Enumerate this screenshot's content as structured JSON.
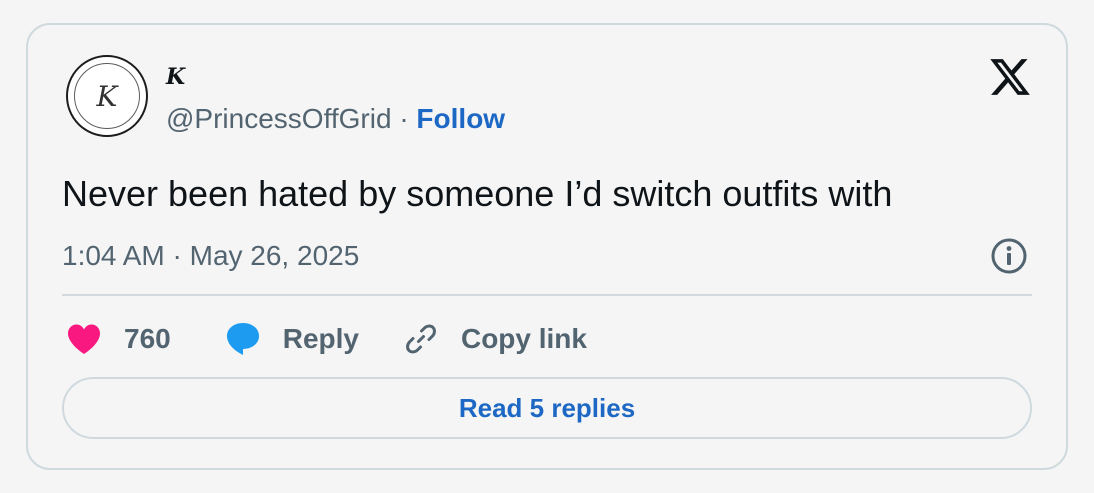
{
  "author": {
    "avatar_letter": "K",
    "display_name": "K",
    "handle": "@PrincessOffGrid",
    "separator": "·",
    "follow_label": "Follow"
  },
  "tweet": {
    "text": "Never been hated by someone I’d switch outfits with",
    "timestamp": "1:04 AM · May 26, 2025"
  },
  "actions": {
    "like_count": "760",
    "reply_label": "Reply",
    "copy_link_label": "Copy link"
  },
  "read_replies_label": "Read 5 replies",
  "icons": {
    "brand": "x-logo-icon",
    "info": "info-icon",
    "like": "heart-icon",
    "reply": "speech-bubble-icon",
    "copy": "link-icon"
  },
  "colors": {
    "background": "#f5f5f5",
    "border": "#cfd9de",
    "link_blue": "#1d68c4",
    "like_pink": "#f91880",
    "reply_blue": "#1d9bf0",
    "secondary_text": "#536471",
    "primary_text": "#0f1419"
  }
}
